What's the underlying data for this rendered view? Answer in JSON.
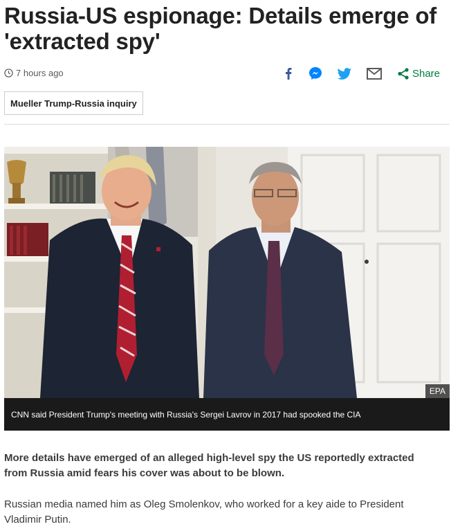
{
  "article": {
    "headline": "Russia-US espionage: Details emerge of 'extracted spy'",
    "timestamp": "7 hours ago",
    "tag": "Mueller Trump-Russia inquiry",
    "share_label": "Share",
    "image_credit": "EPA",
    "image_caption": "CNN said President Trump's meeting with Russia's Sergei Lavrov in 2017 had spooked the CIA",
    "summary": "More details have emerged of an alleged high-level spy the US reportedly extracted from Russia amid fears his cover was about to be blown.",
    "paragraph_1": "Russian media named him as Oleg Smolenkov, who worked for a key aide to President Vladimir Putin."
  },
  "icons": {
    "timestamp": "clock-icon",
    "share_facebook": "facebook-icon",
    "share_messenger": "messenger-icon",
    "share_twitter": "twitter-icon",
    "share_email": "email-icon",
    "share": "share-icon"
  },
  "colors": {
    "facebook": "#3b5998",
    "messenger": "#0084ff",
    "twitter": "#1da1f2",
    "email": "#5a5a5a",
    "share": "#007a3d",
    "caption_bg": "#1a1a1a",
    "text": "#222222"
  }
}
